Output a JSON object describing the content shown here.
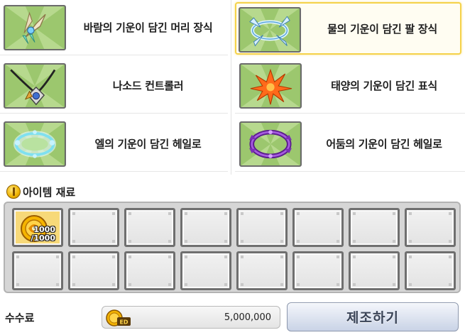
{
  "items": [
    {
      "name": "바람의 기운이 담긴 머리 장식",
      "icon": "wind-head-ornament-icon",
      "selected": false
    },
    {
      "name": "물의 기운이 담긴 팔 장식",
      "icon": "water-arm-ornament-icon",
      "selected": true
    },
    {
      "name": "나소드 컨트롤러",
      "icon": "nasod-controller-icon",
      "selected": false
    },
    {
      "name": "태양의 기운이 담긴 표식",
      "icon": "sun-mark-icon",
      "selected": false
    },
    {
      "name": "엘의 기운이 담긴 헤일로",
      "icon": "el-halo-icon",
      "selected": false
    },
    {
      "name": "어둠의 기운이 담긴 헤일로",
      "icon": "dark-halo-icon",
      "selected": false
    }
  ],
  "materials": {
    "title": "아이템 재료",
    "slots": [
      {
        "icon": "gold-medal-icon",
        "count": "1000",
        "required": "/1000"
      }
    ],
    "total_slots": 16
  },
  "footer": {
    "fee_label": "수수료",
    "fee_value": "5,000,000",
    "currency_icon": "ed-coin-icon",
    "craft_label": "제조하기"
  },
  "colors": {
    "selected_border": "#f5d24a",
    "thumb_background": "#8dbb64"
  }
}
